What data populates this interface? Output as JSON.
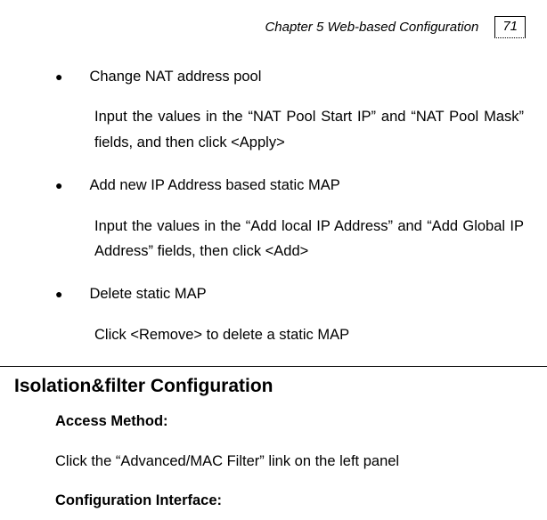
{
  "header": {
    "chapter_label": "Chapter 5 Web-based Configuration",
    "page_number": "71"
  },
  "bullets": [
    {
      "title": "Change NAT address pool",
      "desc": "Input the values in the “NAT Pool Start IP” and “NAT Pool Mask” fields, and then click <Apply>"
    },
    {
      "title": "Add new IP Address based static MAP",
      "desc": "Input the values in the “Add local IP Address” and “Add Global IP Address” fields, then click <Add>"
    },
    {
      "title": "Delete static MAP",
      "desc": "Click <Remove> to delete a static MAP"
    }
  ],
  "section": {
    "title": "Isolation&filter Configuration",
    "access_method_label": "Access Method:",
    "access_method_text": "Click the “Advanced/MAC Filter” link on the left panel",
    "config_interface_label": "Configuration Interface:"
  }
}
